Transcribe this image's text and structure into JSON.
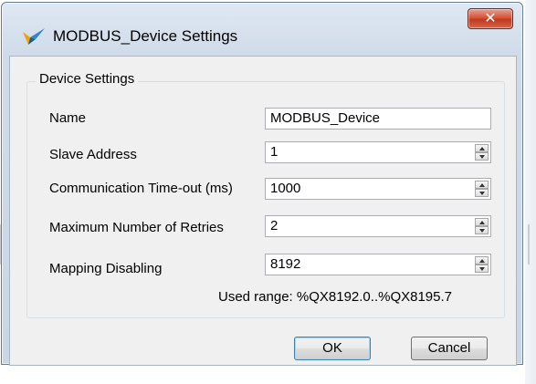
{
  "window": {
    "title": "MODBUS_Device Settings",
    "close_icon": "close-icon",
    "app_icon": "bird-icon"
  },
  "group": {
    "legend": "Device Settings"
  },
  "fields": [
    {
      "label": "Name",
      "value": "MODBUS_Device",
      "spinner": false
    },
    {
      "label": "Slave Address",
      "value": "1",
      "spinner": true
    },
    {
      "label": "Communication Time-out (ms)",
      "value": "1000",
      "spinner": true
    },
    {
      "label": "Maximum Number of Retries",
      "value": "2",
      "spinner": true
    },
    {
      "label": "Mapping Disabling",
      "value": "8192",
      "spinner": true
    }
  ],
  "used_range": "Used range: %QX8192.0..%QX8195.7",
  "buttons": {
    "ok": "OK",
    "cancel": "Cancel"
  },
  "colors": {
    "close_button": "#c0391f",
    "default_button_border": "#3c7fb1",
    "title_gradient": "#cfdbe9"
  }
}
